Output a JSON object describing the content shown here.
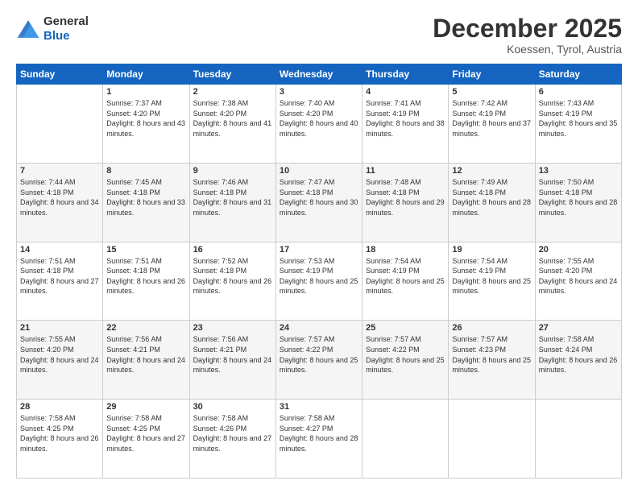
{
  "header": {
    "logo": {
      "line1": "General",
      "line2": "Blue"
    },
    "title": "December 2025",
    "location": "Koessen, Tyrol, Austria"
  },
  "days_of_week": [
    "Sunday",
    "Monday",
    "Tuesday",
    "Wednesday",
    "Thursday",
    "Friday",
    "Saturday"
  ],
  "weeks": [
    [
      {
        "day": "",
        "sunrise": "",
        "sunset": "",
        "daylight": ""
      },
      {
        "day": "1",
        "sunrise": "Sunrise: 7:37 AM",
        "sunset": "Sunset: 4:20 PM",
        "daylight": "Daylight: 8 hours and 43 minutes."
      },
      {
        "day": "2",
        "sunrise": "Sunrise: 7:38 AM",
        "sunset": "Sunset: 4:20 PM",
        "daylight": "Daylight: 8 hours and 41 minutes."
      },
      {
        "day": "3",
        "sunrise": "Sunrise: 7:40 AM",
        "sunset": "Sunset: 4:20 PM",
        "daylight": "Daylight: 8 hours and 40 minutes."
      },
      {
        "day": "4",
        "sunrise": "Sunrise: 7:41 AM",
        "sunset": "Sunset: 4:19 PM",
        "daylight": "Daylight: 8 hours and 38 minutes."
      },
      {
        "day": "5",
        "sunrise": "Sunrise: 7:42 AM",
        "sunset": "Sunset: 4:19 PM",
        "daylight": "Daylight: 8 hours and 37 minutes."
      },
      {
        "day": "6",
        "sunrise": "Sunrise: 7:43 AM",
        "sunset": "Sunset: 4:19 PM",
        "daylight": "Daylight: 8 hours and 35 minutes."
      }
    ],
    [
      {
        "day": "7",
        "sunrise": "Sunrise: 7:44 AM",
        "sunset": "Sunset: 4:18 PM",
        "daylight": "Daylight: 8 hours and 34 minutes."
      },
      {
        "day": "8",
        "sunrise": "Sunrise: 7:45 AM",
        "sunset": "Sunset: 4:18 PM",
        "daylight": "Daylight: 8 hours and 33 minutes."
      },
      {
        "day": "9",
        "sunrise": "Sunrise: 7:46 AM",
        "sunset": "Sunset: 4:18 PM",
        "daylight": "Daylight: 8 hours and 31 minutes."
      },
      {
        "day": "10",
        "sunrise": "Sunrise: 7:47 AM",
        "sunset": "Sunset: 4:18 PM",
        "daylight": "Daylight: 8 hours and 30 minutes."
      },
      {
        "day": "11",
        "sunrise": "Sunrise: 7:48 AM",
        "sunset": "Sunset: 4:18 PM",
        "daylight": "Daylight: 8 hours and 29 minutes."
      },
      {
        "day": "12",
        "sunrise": "Sunrise: 7:49 AM",
        "sunset": "Sunset: 4:18 PM",
        "daylight": "Daylight: 8 hours and 28 minutes."
      },
      {
        "day": "13",
        "sunrise": "Sunrise: 7:50 AM",
        "sunset": "Sunset: 4:18 PM",
        "daylight": "Daylight: 8 hours and 28 minutes."
      }
    ],
    [
      {
        "day": "14",
        "sunrise": "Sunrise: 7:51 AM",
        "sunset": "Sunset: 4:18 PM",
        "daylight": "Daylight: 8 hours and 27 minutes."
      },
      {
        "day": "15",
        "sunrise": "Sunrise: 7:51 AM",
        "sunset": "Sunset: 4:18 PM",
        "daylight": "Daylight: 8 hours and 26 minutes."
      },
      {
        "day": "16",
        "sunrise": "Sunrise: 7:52 AM",
        "sunset": "Sunset: 4:18 PM",
        "daylight": "Daylight: 8 hours and 26 minutes."
      },
      {
        "day": "17",
        "sunrise": "Sunrise: 7:53 AM",
        "sunset": "Sunset: 4:19 PM",
        "daylight": "Daylight: 8 hours and 25 minutes."
      },
      {
        "day": "18",
        "sunrise": "Sunrise: 7:54 AM",
        "sunset": "Sunset: 4:19 PM",
        "daylight": "Daylight: 8 hours and 25 minutes."
      },
      {
        "day": "19",
        "sunrise": "Sunrise: 7:54 AM",
        "sunset": "Sunset: 4:19 PM",
        "daylight": "Daylight: 8 hours and 25 minutes."
      },
      {
        "day": "20",
        "sunrise": "Sunrise: 7:55 AM",
        "sunset": "Sunset: 4:20 PM",
        "daylight": "Daylight: 8 hours and 24 minutes."
      }
    ],
    [
      {
        "day": "21",
        "sunrise": "Sunrise: 7:55 AM",
        "sunset": "Sunset: 4:20 PM",
        "daylight": "Daylight: 8 hours and 24 minutes."
      },
      {
        "day": "22",
        "sunrise": "Sunrise: 7:56 AM",
        "sunset": "Sunset: 4:21 PM",
        "daylight": "Daylight: 8 hours and 24 minutes."
      },
      {
        "day": "23",
        "sunrise": "Sunrise: 7:56 AM",
        "sunset": "Sunset: 4:21 PM",
        "daylight": "Daylight: 8 hours and 24 minutes."
      },
      {
        "day": "24",
        "sunrise": "Sunrise: 7:57 AM",
        "sunset": "Sunset: 4:22 PM",
        "daylight": "Daylight: 8 hours and 25 minutes."
      },
      {
        "day": "25",
        "sunrise": "Sunrise: 7:57 AM",
        "sunset": "Sunset: 4:22 PM",
        "daylight": "Daylight: 8 hours and 25 minutes."
      },
      {
        "day": "26",
        "sunrise": "Sunrise: 7:57 AM",
        "sunset": "Sunset: 4:23 PM",
        "daylight": "Daylight: 8 hours and 25 minutes."
      },
      {
        "day": "27",
        "sunrise": "Sunrise: 7:58 AM",
        "sunset": "Sunset: 4:24 PM",
        "daylight": "Daylight: 8 hours and 26 minutes."
      }
    ],
    [
      {
        "day": "28",
        "sunrise": "Sunrise: 7:58 AM",
        "sunset": "Sunset: 4:25 PM",
        "daylight": "Daylight: 8 hours and 26 minutes."
      },
      {
        "day": "29",
        "sunrise": "Sunrise: 7:58 AM",
        "sunset": "Sunset: 4:25 PM",
        "daylight": "Daylight: 8 hours and 27 minutes."
      },
      {
        "day": "30",
        "sunrise": "Sunrise: 7:58 AM",
        "sunset": "Sunset: 4:26 PM",
        "daylight": "Daylight: 8 hours and 27 minutes."
      },
      {
        "day": "31",
        "sunrise": "Sunrise: 7:58 AM",
        "sunset": "Sunset: 4:27 PM",
        "daylight": "Daylight: 8 hours and 28 minutes."
      },
      {
        "day": "",
        "sunrise": "",
        "sunset": "",
        "daylight": ""
      },
      {
        "day": "",
        "sunrise": "",
        "sunset": "",
        "daylight": ""
      },
      {
        "day": "",
        "sunrise": "",
        "sunset": "",
        "daylight": ""
      }
    ]
  ]
}
